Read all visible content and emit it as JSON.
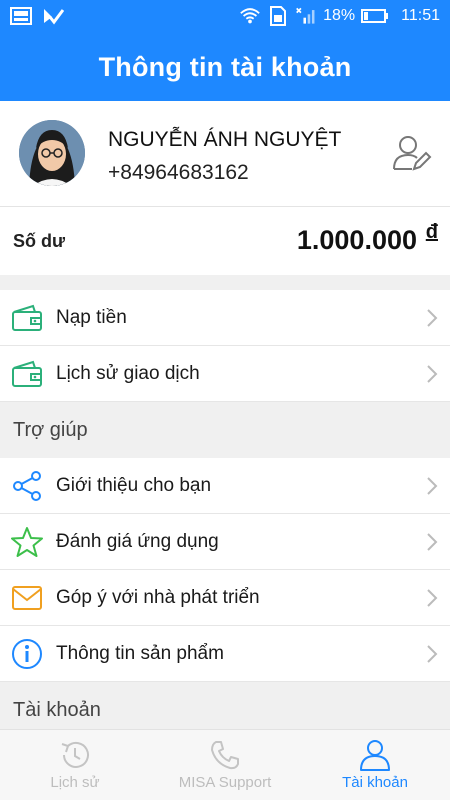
{
  "status_bar": {
    "battery": "18%",
    "time": "11:51"
  },
  "header": {
    "title": "Thông tin tài khoản"
  },
  "profile": {
    "name": "NGUYỄN ÁNH NGUYỆT",
    "phone": "+84964683162"
  },
  "balance": {
    "label": "Số dư",
    "value": "1.000.000",
    "currency": "đ"
  },
  "menu_top": [
    {
      "label": "Nạp tiền",
      "icon": "wallet-icon"
    },
    {
      "label": "Lịch sử giao dịch",
      "icon": "wallet-icon"
    }
  ],
  "help_section": {
    "title": "Trợ giúp",
    "items": [
      {
        "label": "Giới thiệu cho bạn",
        "icon": "share-icon"
      },
      {
        "label": "Đánh giá ứng dụng",
        "icon": "star-icon"
      },
      {
        "label": "Góp ý với nhà phát triển",
        "icon": "mail-icon"
      },
      {
        "label": "Thông tin sản phẩm",
        "icon": "info-icon"
      }
    ]
  },
  "account_section": {
    "title": "Tài khoản"
  },
  "bottom_nav": [
    {
      "label": "Lịch sử",
      "icon": "history-icon",
      "active": false
    },
    {
      "label": "MISA Support",
      "icon": "phone-icon",
      "active": false
    },
    {
      "label": "Tài khoản",
      "icon": "user-icon",
      "active": true
    }
  ],
  "colors": {
    "primary": "#1e88ff",
    "wallet_green": "#2bb07a",
    "share_blue": "#1e88ff",
    "star_green": "#3cbf4a",
    "mail_orange": "#f0a020",
    "info_blue": "#1e88ff",
    "inactive_nav": "#bdbdbd"
  }
}
